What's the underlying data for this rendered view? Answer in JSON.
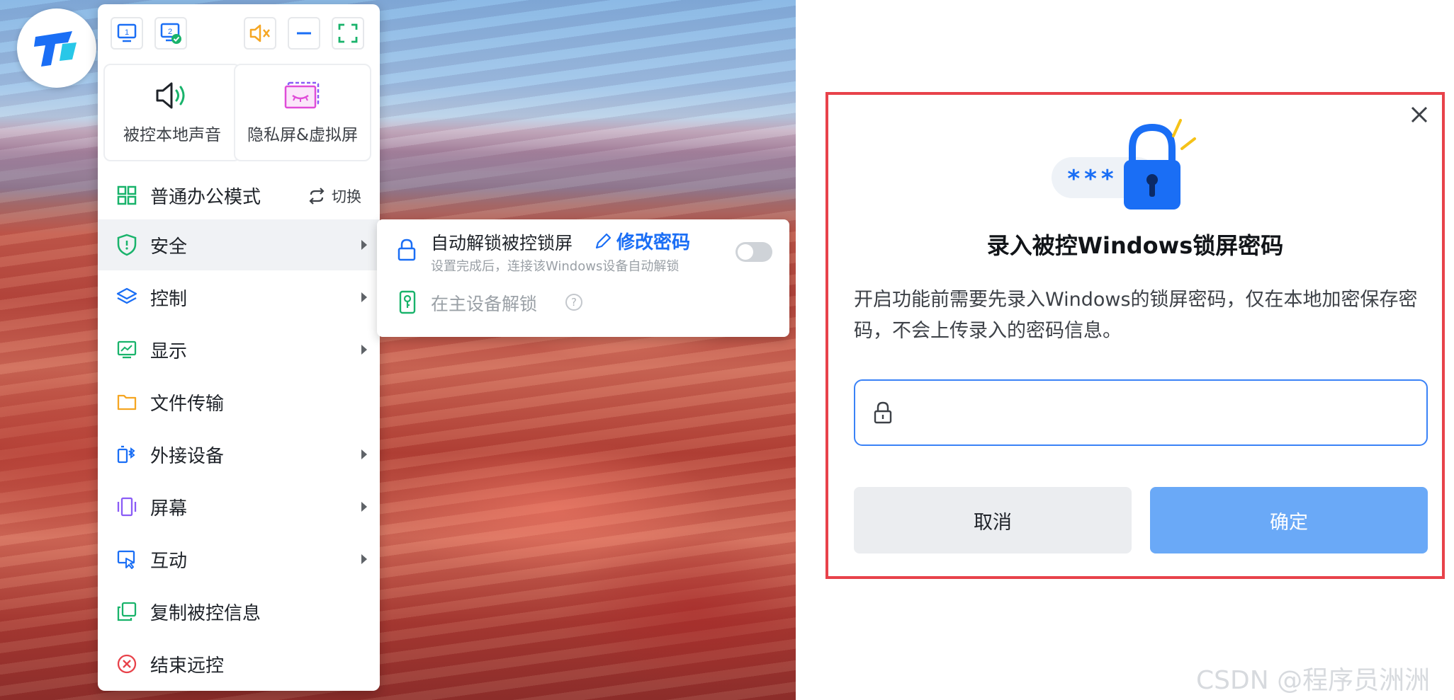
{
  "toolbar": {
    "buttons": [
      {
        "icon": "monitor-1-icon",
        "text": "1"
      },
      {
        "icon": "monitor-2-checked-icon",
        "text": "2"
      },
      {
        "icon": "mute-speaker-icon",
        "color": "#f5a623"
      },
      {
        "icon": "minimize-icon",
        "color": "#1a6ef5"
      },
      {
        "icon": "fullscreen-icon",
        "color": "#19b36b"
      }
    ]
  },
  "cards": {
    "sound_label": "被控本地声音",
    "privacy_label": "隐私屏&虚拟屏"
  },
  "menu": {
    "mode_label": "普通办公模式",
    "switch_label": "切换",
    "items": [
      {
        "label": "安全",
        "icon": "shield-icon",
        "has_submenu": true,
        "active": true
      },
      {
        "label": "控制",
        "icon": "layers-icon",
        "has_submenu": true
      },
      {
        "label": "显示",
        "icon": "display-icon",
        "has_submenu": true
      },
      {
        "label": "文件传输",
        "icon": "folder-icon",
        "has_submenu": false
      },
      {
        "label": "外接设备",
        "icon": "bluetooth-device-icon",
        "has_submenu": true
      },
      {
        "label": "屏幕",
        "icon": "screen-icon",
        "has_submenu": true
      },
      {
        "label": "互动",
        "icon": "interaction-icon",
        "has_submenu": true
      },
      {
        "label": "复制被控信息",
        "icon": "copy-icon",
        "has_submenu": false
      },
      {
        "label": "结束远控",
        "icon": "end-circle-x-icon",
        "has_submenu": false
      }
    ]
  },
  "submenu": {
    "title": "自动解锁被控锁屏",
    "edit_label": "修改密码",
    "description": "设置完成后，连接该Windows设备自动解锁",
    "toggle_on": false,
    "device_unlock_label": "在主设备解锁",
    "help_glyph": "?"
  },
  "dialog": {
    "illustration_text": "***",
    "title": "录入被控Windows锁屏密码",
    "description": "开启功能前需要先录入Windows的锁屏密码，仅在本地加密保存密码，不会上传录入的密码信息。",
    "password": {
      "value": "",
      "placeholder": ""
    },
    "cancel_label": "取消",
    "confirm_label": "确定"
  },
  "colors": {
    "accent": "#1a6ef5",
    "confirm_button": "#6aa9f7",
    "highlight_frame": "#e8424a",
    "icon_green": "#19b36b",
    "icon_orange": "#f5a623",
    "icon_purple": "#8a5cf6",
    "icon_pink": "#e04cd8"
  },
  "watermark": "CSDN @程序员洲洲"
}
